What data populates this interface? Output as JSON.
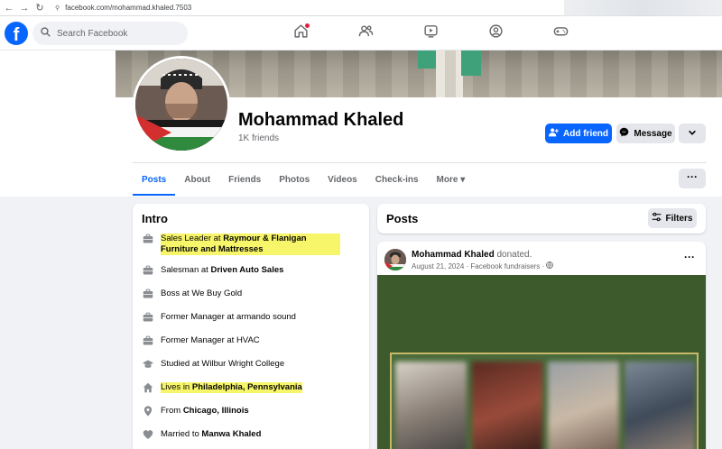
{
  "browser": {
    "url": "facebook.com/mohammad.khaled.7503",
    "back_icon": "arrow-left-icon",
    "forward_icon": "arrow-right-icon",
    "reload_icon": "reload-icon"
  },
  "topbar": {
    "logo": "f",
    "search_placeholder": "Search Facebook",
    "nav_icons": [
      "home-icon",
      "friends-icon",
      "video-icon",
      "groups-icon",
      "gaming-icon"
    ]
  },
  "profile": {
    "name": "Mohammad Khaled",
    "friends": "1K friends",
    "add_friend": "Add friend",
    "message": "Message"
  },
  "tabs": [
    {
      "label": "Posts",
      "active": true
    },
    {
      "label": "About"
    },
    {
      "label": "Friends"
    },
    {
      "label": "Photos"
    },
    {
      "label": "Videos"
    },
    {
      "label": "Check-ins"
    },
    {
      "label": "More ▾"
    }
  ],
  "intro": {
    "title": "Intro",
    "items": [
      {
        "icon": "briefcase-icon",
        "prefix": "Sales Leader at ",
        "bold": "Raymour & Flanigan Furniture and Mattresses",
        "highlight": true
      },
      {
        "icon": "briefcase-icon",
        "prefix": "Salesman at ",
        "bold": "Driven Auto Sales"
      },
      {
        "icon": "briefcase-icon",
        "prefix": "Boss at We Buy Gold",
        "bold": ""
      },
      {
        "icon": "briefcase-icon",
        "prefix": "Former Manager at armando sound",
        "bold": ""
      },
      {
        "icon": "briefcase-icon",
        "prefix": "Former Manager at HVAC",
        "bold": ""
      },
      {
        "icon": "graduation-cap-icon",
        "prefix": "Studied at Wilbur Wright College",
        "bold": ""
      },
      {
        "icon": "home-icon",
        "prefix": "Lives in ",
        "bold": "Philadelphia, Pennsylvania",
        "highlight": true
      },
      {
        "icon": "location-pin-icon",
        "prefix": "From ",
        "bold": "Chicago, Illinois"
      },
      {
        "icon": "heart-icon",
        "prefix": "Married to ",
        "bold": "Manwa Khaled"
      }
    ]
  },
  "posts": {
    "title": "Posts",
    "filters": "Filters",
    "post": {
      "author": "Mohammad Khaled",
      "action": "donated.",
      "meta": "August 21, 2024 · Facebook fundraisers · "
    }
  },
  "colors": {
    "brand": "#0866ff",
    "highlight": "#f7f66a",
    "post_image": "#3d5a2c"
  }
}
